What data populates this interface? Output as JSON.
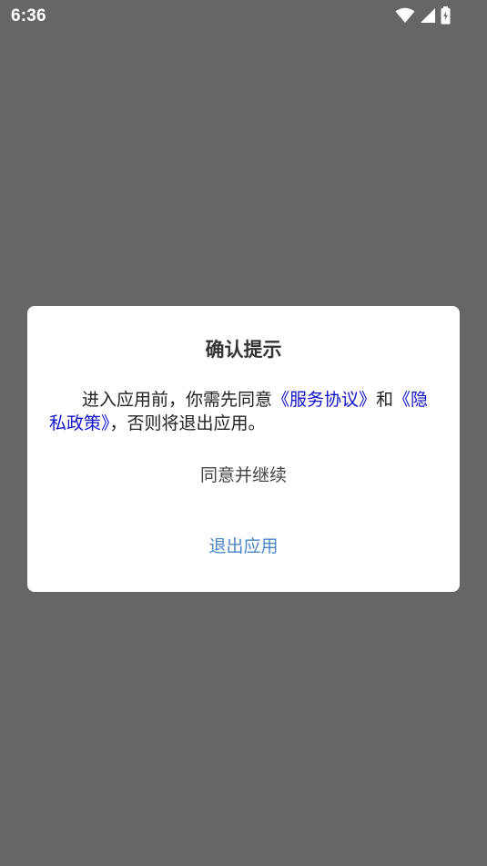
{
  "status_bar": {
    "time": "6:36",
    "icons": [
      "wifi-icon",
      "cell-signal-icon",
      "battery-charging-icon"
    ]
  },
  "dialog": {
    "title": "确认提示",
    "message": {
      "prefix": "进入应用前，你需先同意",
      "service_link": "《服务协议》",
      "connector": "和",
      "privacy_link": "《隐私政策》",
      "suffix": "，否则将退出应用。"
    },
    "agree_label": "同意并继续",
    "exit_label": "退出应用"
  },
  "colors": {
    "overlay": "#666666",
    "dialog_bg": "#ffffff",
    "link": "#1111cc",
    "exit_button": "#4a86c6"
  }
}
